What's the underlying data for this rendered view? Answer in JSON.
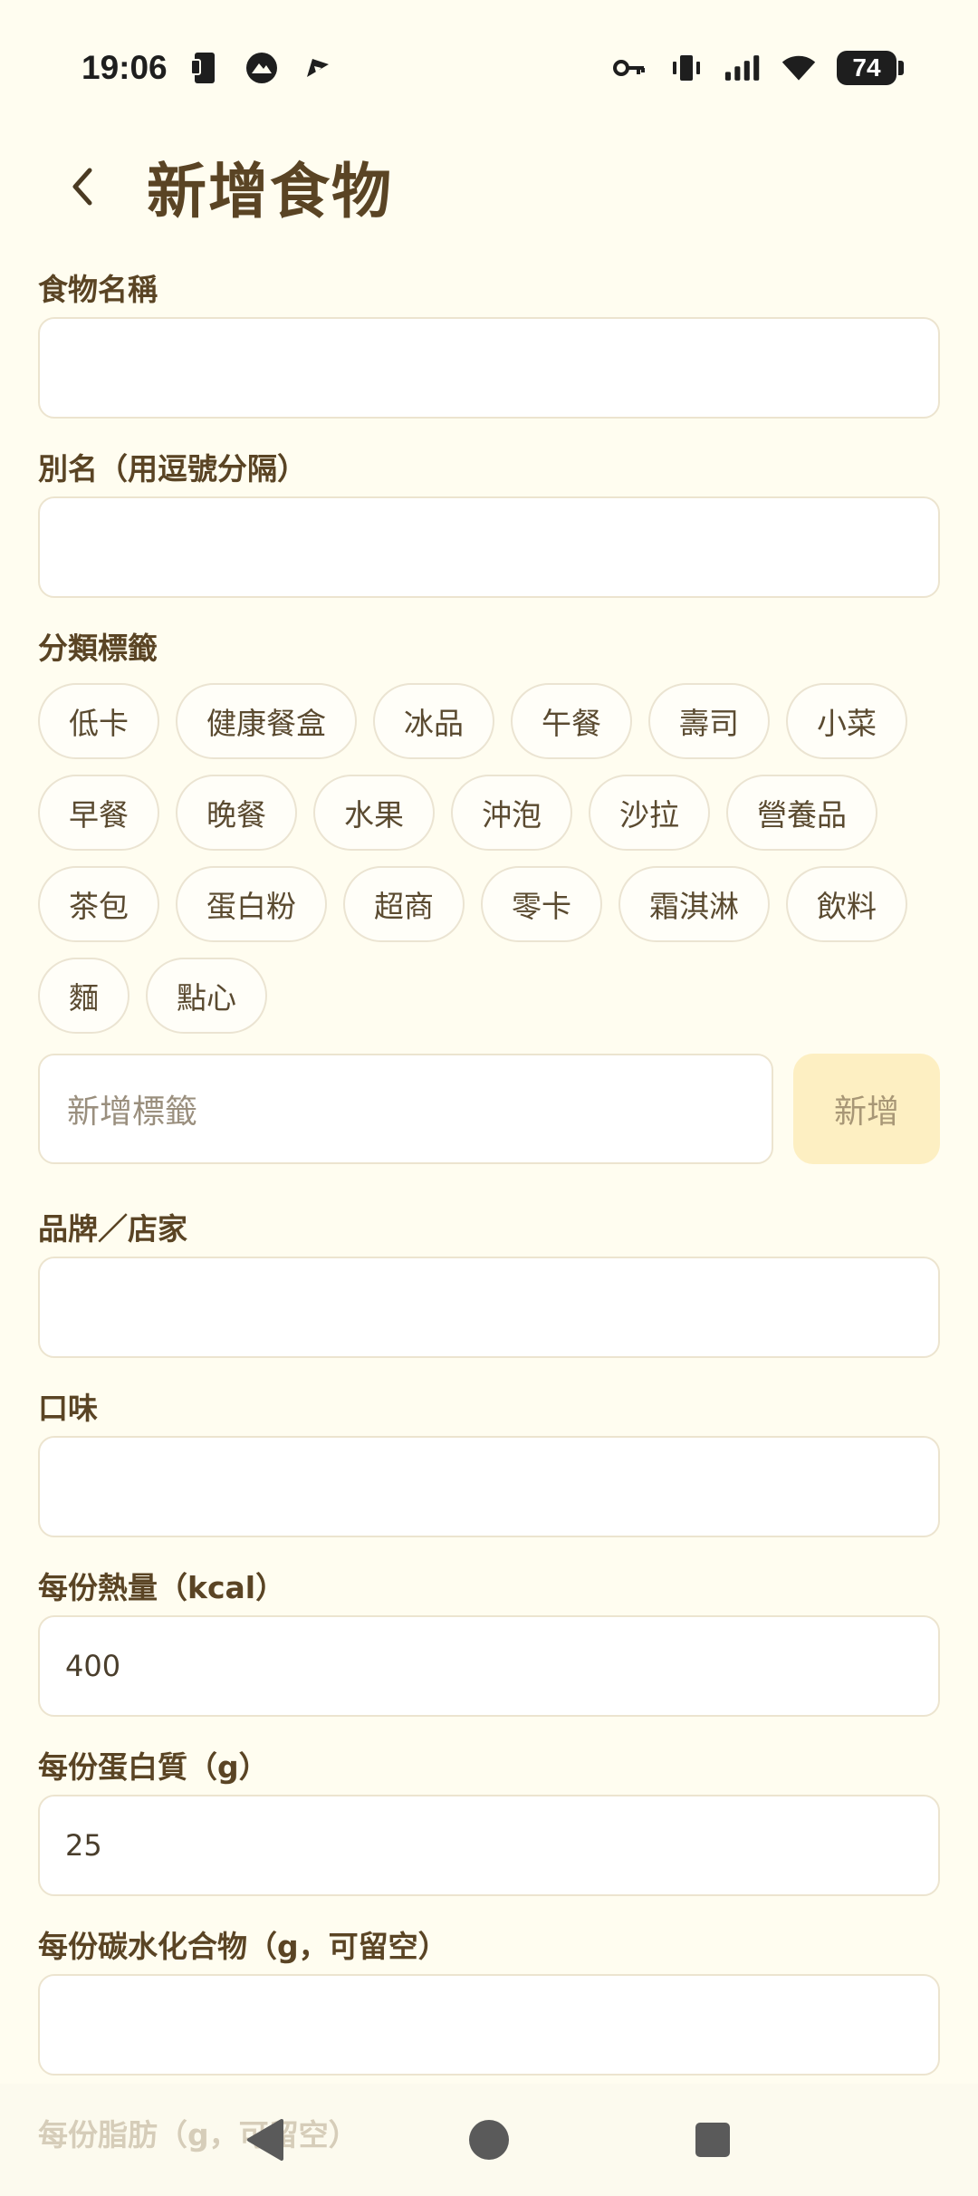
{
  "status_bar": {
    "time": "19:06",
    "battery": "74"
  },
  "header": {
    "title": "新增食物"
  },
  "form": {
    "food_name": {
      "label": "食物名稱",
      "value": ""
    },
    "alias": {
      "label": "別名（用逗號分隔）",
      "value": ""
    },
    "tags": {
      "label": "分類標籤",
      "items": [
        "低卡",
        "健康餐盒",
        "冰品",
        "午餐",
        "壽司",
        "小菜",
        "早餐",
        "晚餐",
        "水果",
        "沖泡",
        "沙拉",
        "營養品",
        "茶包",
        "蛋白粉",
        "超商",
        "零卡",
        "霜淇淋",
        "飲料",
        "麵",
        "點心"
      ],
      "new_tag_placeholder": "新增標籤",
      "add_button": "新增"
    },
    "brand": {
      "label": "品牌／店家",
      "value": ""
    },
    "flavor": {
      "label": "口味",
      "value": ""
    },
    "calories": {
      "label": "每份熱量（kcal）",
      "value": "400"
    },
    "protein": {
      "label": "每份蛋白質（g）",
      "value": "25"
    },
    "carbs": {
      "label": "每份碳水化合物（g，可留空）",
      "value": ""
    },
    "fat": {
      "label": "每份脂肪（g，可留空）",
      "value": ""
    }
  }
}
